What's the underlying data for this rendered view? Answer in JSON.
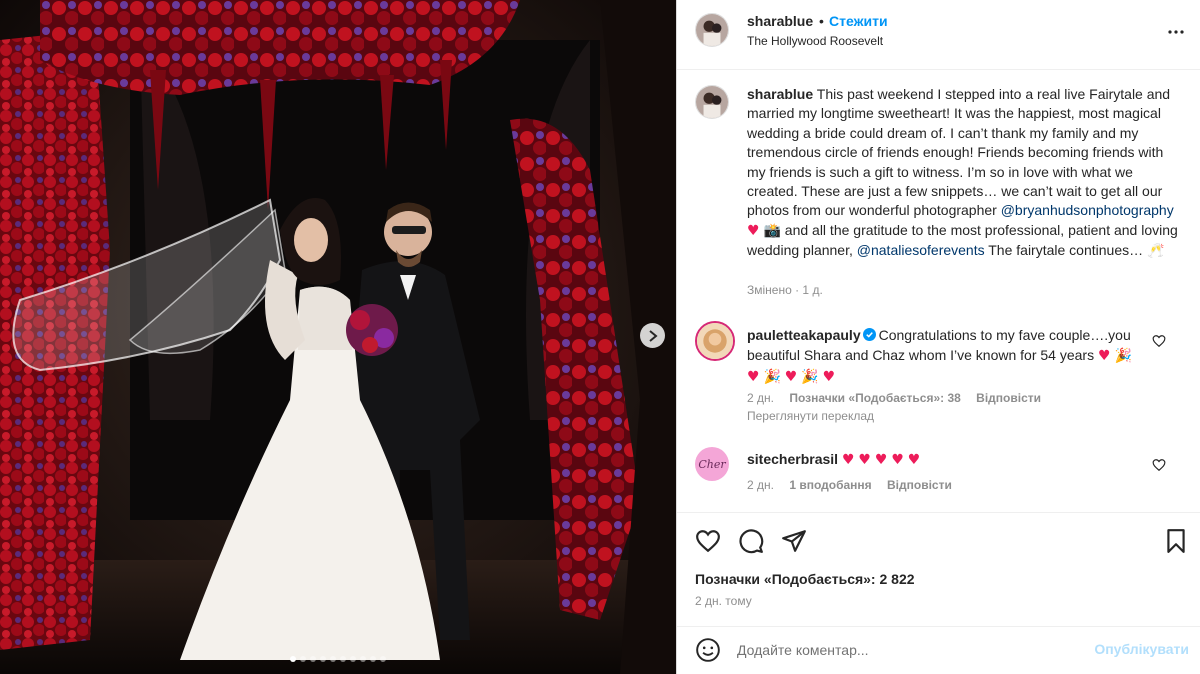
{
  "post": {
    "username": "sharablue",
    "separator": "•",
    "follow_label": "Стежити",
    "location": "The Hollywood Roosevelt",
    "more_icon": "more-horizontal-icon"
  },
  "media": {
    "slide_count": 10,
    "active_slide": 1,
    "next_icon": "chevron-right-icon"
  },
  "caption": {
    "username": "sharablue",
    "text_1": "This past weekend I stepped into a real live Fairytale and married my longtime sweetheart! It was the happiest, most magical wedding a bride could dream of. I can’t thank my family and my tremendous circle of friends enough! Friends becoming friends with my friends is such a gift to witness. I’m so in love with what we created. These are just a few snippets… we can’t wait to get all our photos from our wonderful photographer",
    "mention_1": "@bryanhudsonphotography",
    "emoji_1": "📸",
    "text_2": "and all the gratitude to the most professional, patient and loving wedding planner,",
    "mention_2": "@nataliesoferevents",
    "text_3": "The fairytale continues…",
    "emoji_3": "🥂",
    "meta": "Змінено · 1 д."
  },
  "comments": [
    {
      "username": "pauletteakapauly",
      "verified": true,
      "text": "Congratulations to my fave couple….you beautiful Shara and Chaz whom I’ve known for 54 years",
      "emoji_line_1": "🎉",
      "emoji_line_2": "🎉",
      "emoji_line_3": "🎉",
      "time": "2 дн.",
      "likes": "Позначки «Подобається»: 38",
      "reply": "Відповісти",
      "translate": "Переглянути переклад"
    },
    {
      "username": "sitecherbrasil",
      "avatar_text": "Cher",
      "hearts": "♥",
      "time": "2 дн.",
      "likes": "1 вподобання",
      "reply": "Відповісти"
    }
  ],
  "actions": {
    "like_icon": "heart-icon",
    "comment_icon": "comment-icon",
    "share_icon": "send-icon",
    "save_icon": "bookmark-icon",
    "likes_text": "Позначки «Подобається»: 2 822",
    "posted_time": "2 дн. тому"
  },
  "add_comment": {
    "emoji_icon": "smiley-icon",
    "placeholder": "Додайте коментар...",
    "publish_label": "Опублікувати"
  },
  "colors": {
    "accent": "#0095f6",
    "mention": "#00376b",
    "muted": "#8e8e8e",
    "publish_disabled": "#b2dffc",
    "heart": "#ed1c5a"
  }
}
